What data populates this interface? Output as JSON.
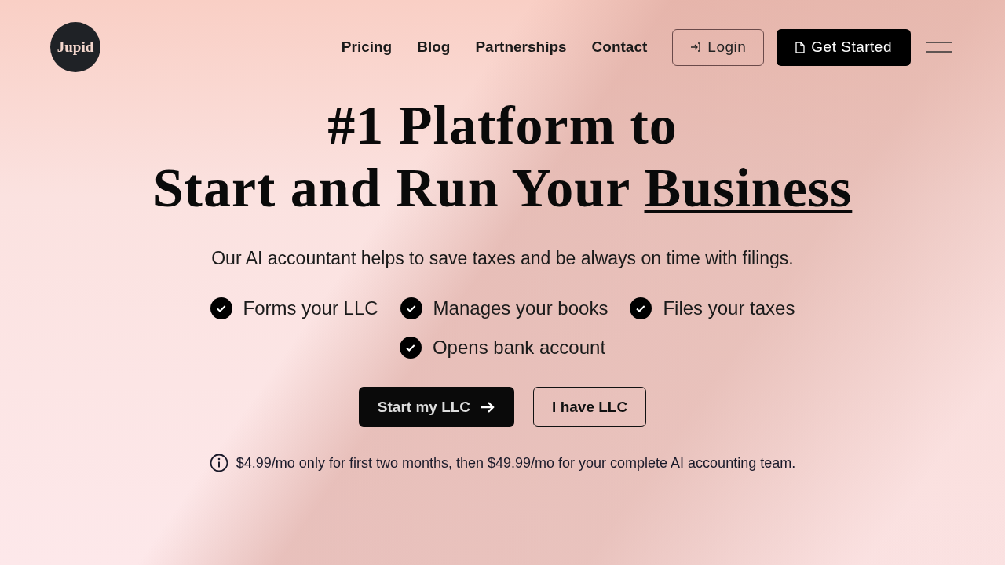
{
  "logo": {
    "text": "Jupid"
  },
  "nav": {
    "links": [
      "Pricing",
      "Blog",
      "Partnerships",
      "Contact"
    ],
    "login": "Login",
    "get_started": "Get Started"
  },
  "hero": {
    "headline_lines": [
      "#1 Platform to",
      "Start and Run Your"
    ],
    "headline_underlined": "Business",
    "subtitle": "Our AI accountant helps to save taxes and be always on time with filings.",
    "features": [
      "Forms your LLC",
      "Manages your books",
      "Files your taxes",
      "Opens bank account"
    ],
    "primary_button": "Start my LLC",
    "secondary_button": "I have LLC",
    "note": "$4.99/mo only for first two months, then $49.99/mo for your complete AI accounting team."
  }
}
